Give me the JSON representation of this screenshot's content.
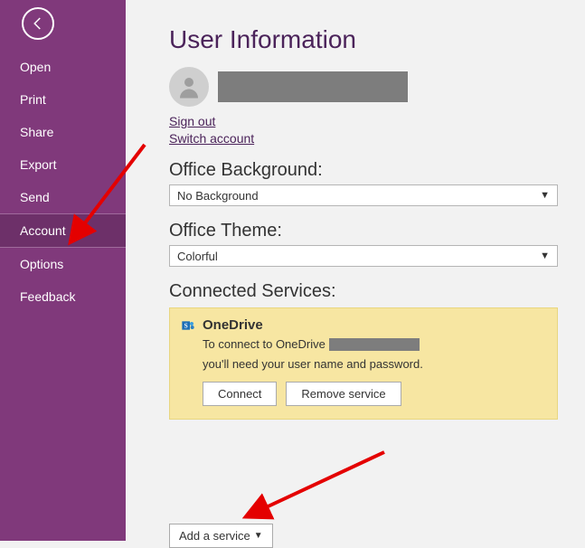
{
  "sidebar": {
    "items": [
      {
        "label": "Open"
      },
      {
        "label": "Print"
      },
      {
        "label": "Share"
      },
      {
        "label": "Export"
      },
      {
        "label": "Send"
      },
      {
        "label": "Account"
      },
      {
        "label": "Options"
      },
      {
        "label": "Feedback"
      }
    ]
  },
  "page": {
    "title": "User Information",
    "sign_out": "Sign out",
    "switch_account": "Switch account"
  },
  "background": {
    "label": "Office Background:",
    "value": "No Background"
  },
  "theme": {
    "label": "Office Theme:",
    "value": "Colorful"
  },
  "connected": {
    "label": "Connected Services:",
    "service_name": "OneDrive",
    "desc_prefix": "To connect to OneDrive",
    "desc_suffix": "you'll need your user name and password.",
    "connect": "Connect",
    "remove": "Remove service"
  },
  "add_service": {
    "label": "Add a service"
  }
}
